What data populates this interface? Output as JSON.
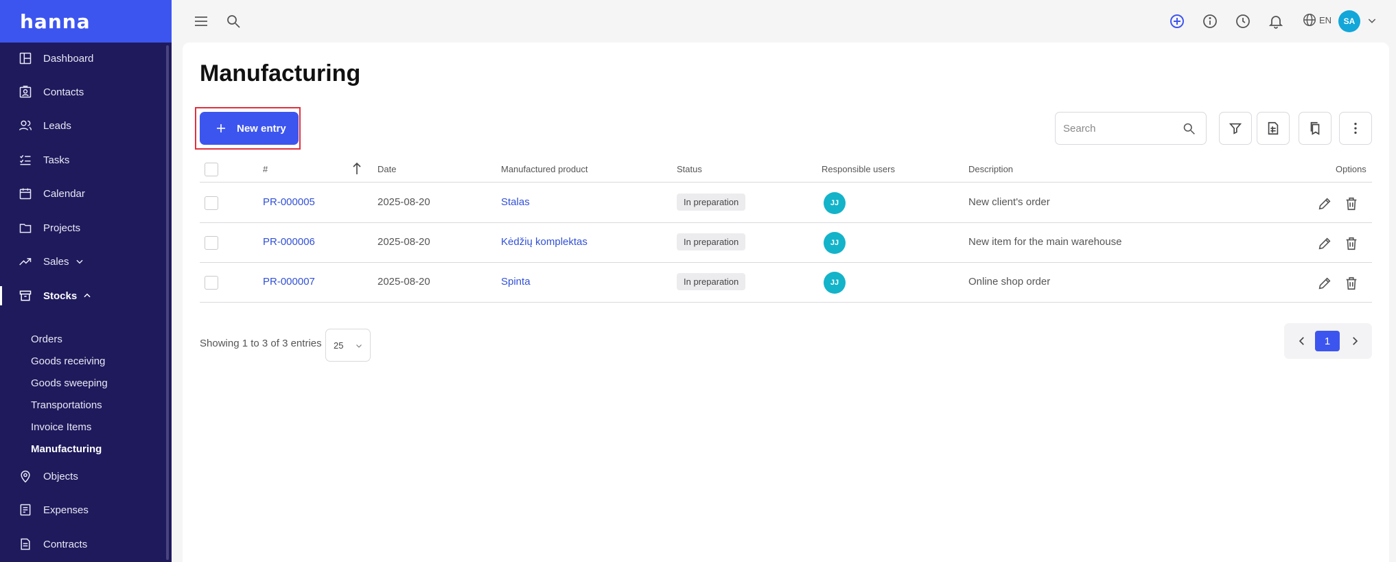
{
  "brand": {
    "name": "hanna"
  },
  "sidebar": {
    "items": [
      {
        "label": "Dashboard",
        "icon": "dashboard-icon"
      },
      {
        "label": "Contacts",
        "icon": "contacts-icon"
      },
      {
        "label": "Leads",
        "icon": "leads-icon"
      },
      {
        "label": "Tasks",
        "icon": "tasks-icon"
      },
      {
        "label": "Calendar",
        "icon": "calendar-icon"
      },
      {
        "label": "Projects",
        "icon": "folder-icon"
      },
      {
        "label": "Sales",
        "icon": "trending-up-icon"
      },
      {
        "label": "Stocks",
        "icon": "archive-icon"
      },
      {
        "label": "Objects",
        "icon": "map-pin-icon"
      },
      {
        "label": "Expenses",
        "icon": "receipt-icon"
      },
      {
        "label": "Contracts",
        "icon": "contract-icon"
      }
    ],
    "stocks_sub": [
      {
        "label": "Orders"
      },
      {
        "label": "Goods receiving"
      },
      {
        "label": "Goods sweeping"
      },
      {
        "label": "Transportations"
      },
      {
        "label": "Invoice Items"
      },
      {
        "label": "Manufacturing"
      }
    ]
  },
  "topbar": {
    "language": "EN",
    "user_initials": "SA"
  },
  "page": {
    "title": "Manufacturing",
    "new_entry_label": "New entry",
    "search_placeholder": "Search"
  },
  "table": {
    "headers": {
      "number": "#",
      "date": "Date",
      "product": "Manufactured product",
      "status": "Status",
      "users": "Responsible users",
      "description": "Description",
      "options": "Options"
    },
    "rows": [
      {
        "number": "PR-000005",
        "date": "2025-08-20",
        "product": "Stalas",
        "status": "In preparation",
        "user": "JJ",
        "description": "New client's order"
      },
      {
        "number": "PR-000006",
        "date": "2025-08-20",
        "product": "Kėdžių komplektas",
        "status": "In preparation",
        "user": "JJ",
        "description": "New item for the main warehouse"
      },
      {
        "number": "PR-000007",
        "date": "2025-08-20",
        "product": "Spinta",
        "status": "In preparation",
        "user": "JJ",
        "description": "Online shop order"
      }
    ]
  },
  "footer": {
    "showing": "Showing 1 to 3 of 3 entries",
    "page_size": "25",
    "current_page": "1"
  },
  "colors": {
    "accent": "#3d55ef",
    "sidebar": "#1f1a5c",
    "link": "#3150d6",
    "highlight_outline": "#e0303c"
  }
}
